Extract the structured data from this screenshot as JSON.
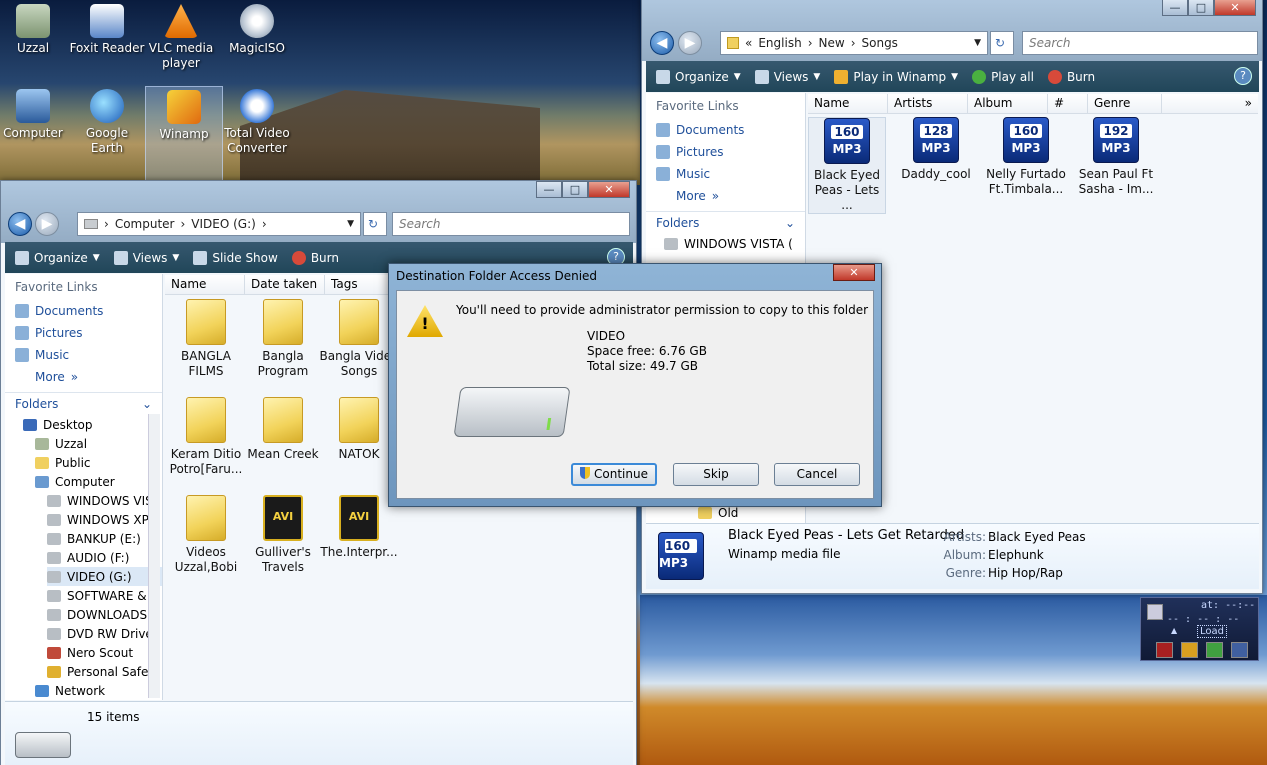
{
  "desktop": {
    "icons": [
      {
        "label": "Uzzal"
      },
      {
        "label": "Foxit Reader"
      },
      {
        "label": "VLC media player"
      },
      {
        "label": "MagicISO"
      },
      {
        "label": "Computer"
      },
      {
        "label": "Google Earth"
      },
      {
        "label": "Winamp"
      },
      {
        "label": "Total Video Converter"
      }
    ]
  },
  "left_window": {
    "address": [
      "Computer",
      "VIDEO (G:)"
    ],
    "search_placeholder": "Search",
    "toolbar": {
      "organize": "Organize",
      "views": "Views",
      "slideshow": "Slide Show",
      "burn": "Burn"
    },
    "favorites_header": "Favorite Links",
    "favorites": [
      "Documents",
      "Pictures",
      "Music",
      "More"
    ],
    "folders_header": "Folders",
    "tree": [
      "Desktop",
      "Uzzal",
      "Public",
      "Computer",
      "WINDOWS VIS",
      "WINDOWS XP",
      "BANKUP (E:)",
      "AUDIO (F:)",
      "VIDEO (G:)",
      "SOFTWARE &",
      "DOWNLOADS",
      "DVD RW Drive",
      "Nero Scout",
      "Personal Safe",
      "Network"
    ],
    "columns": [
      "Name",
      "Date taken",
      "Tags"
    ],
    "files": [
      {
        "name": "BANGLA FILMS"
      },
      {
        "name": "Bangla Program"
      },
      {
        "name": "Bangla Video Songs"
      },
      {
        "name": "Keram Ditio Potro[Faru..."
      },
      {
        "name": "Mean Creek"
      },
      {
        "name": "NATOK"
      },
      {
        "name": "Videos Uzzal,Bobi"
      },
      {
        "name": "Gulliver's Travels",
        "type": "AVI"
      },
      {
        "name": "The.Interpr...",
        "type": "AVI"
      }
    ],
    "status": "15 items"
  },
  "right_window": {
    "address": [
      "English",
      "New",
      "Songs"
    ],
    "search_placeholder": "Search",
    "toolbar": {
      "organize": "Organize",
      "views": "Views",
      "play_winamp": "Play in Winamp",
      "play_all": "Play all",
      "burn": "Burn"
    },
    "favorites_header": "Favorite Links",
    "favorites": [
      "Documents",
      "Pictures",
      "Music",
      "More"
    ],
    "folders_header": "Folders",
    "tree": [
      "WINDOWS VISTA (",
      "Old"
    ],
    "columns": [
      "Name",
      "Artists",
      "Album",
      "#",
      "Genre"
    ],
    "files": [
      {
        "name": "Black Eyed Peas - Lets ...",
        "bitrate": "160",
        "format": "MP3"
      },
      {
        "name": "Daddy_cool",
        "bitrate": "128",
        "format": "MP3"
      },
      {
        "name": "Nelly Furtado Ft.Timbala...",
        "bitrate": "160",
        "format": "MP3"
      },
      {
        "name": "Sean Paul Ft Sasha - Im...",
        "bitrate": "192",
        "format": "MP3"
      }
    ],
    "details": {
      "title": "Black Eyed Peas - Lets Get Retarded",
      "type": "Winamp media file",
      "artists_label": "Artists:",
      "artists": "Black Eyed Peas",
      "album_label": "Album:",
      "album": "Elephunk",
      "genre_label": "Genre:",
      "genre": "Hip Hop/Rap",
      "icon_bitrate": "160",
      "icon_format": "MP3"
    }
  },
  "dialog": {
    "title": "Destination Folder Access Denied",
    "message": "You'll need to provide administrator permission to copy to this folder",
    "drive_name": "VIDEO",
    "space_free": "Space free: 6.76 GB",
    "total_size": "Total size: 49.7 GB",
    "continue": "Continue",
    "skip": "Skip",
    "cancel": "Cancel"
  },
  "winamp_mini": {
    "time": "at: --:--",
    "load": "Load"
  }
}
